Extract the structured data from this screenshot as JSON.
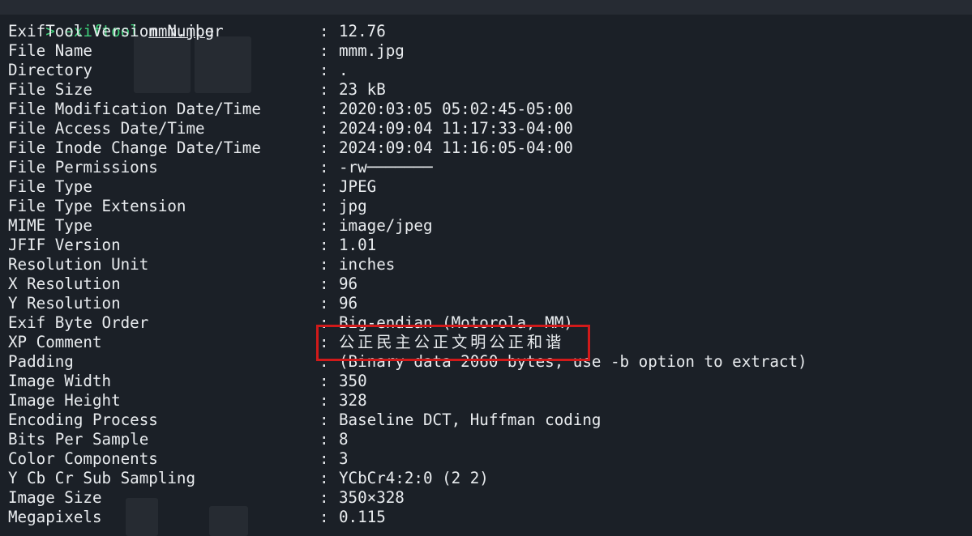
{
  "prompt": {
    "arrow": ">",
    "command": "exiftool",
    "argument": "mmm.jpg"
  },
  "rows": [
    {
      "key": "ExifTool Version Number",
      "value": "12.76"
    },
    {
      "key": "File Name",
      "value": "mmm.jpg"
    },
    {
      "key": "Directory",
      "value": "."
    },
    {
      "key": "File Size",
      "value": "23 kB"
    },
    {
      "key": "File Modification Date/Time",
      "value": "2020:03:05 05:02:45-05:00"
    },
    {
      "key": "File Access Date/Time",
      "value": "2024:09:04 11:17:33-04:00"
    },
    {
      "key": "File Inode Change Date/Time",
      "value": "2024:09:04 11:16:05-04:00"
    },
    {
      "key": "File Permissions",
      "value": "-rw───────"
    },
    {
      "key": "File Type",
      "value": "JPEG"
    },
    {
      "key": "File Type Extension",
      "value": "jpg"
    },
    {
      "key": "MIME Type",
      "value": "image/jpeg"
    },
    {
      "key": "JFIF Version",
      "value": "1.01"
    },
    {
      "key": "Resolution Unit",
      "value": "inches"
    },
    {
      "key": "X Resolution",
      "value": "96"
    },
    {
      "key": "Y Resolution",
      "value": "96"
    },
    {
      "key": "Exif Byte Order",
      "value": "Big-endian (Motorola, MM)"
    },
    {
      "key": "XP Comment",
      "value": "公正民主公正文明公正和谐"
    },
    {
      "key": "Padding",
      "value": "(Binary data 2060 bytes, use -b option to extract)"
    },
    {
      "key": "Image Width",
      "value": "350"
    },
    {
      "key": "Image Height",
      "value": "328"
    },
    {
      "key": "Encoding Process",
      "value": "Baseline DCT, Huffman coding"
    },
    {
      "key": "Bits Per Sample",
      "value": "8"
    },
    {
      "key": "Color Components",
      "value": "3"
    },
    {
      "key": "Y Cb Cr Sub Sampling",
      "value": "YCbCr4:2:0 (2 2)"
    },
    {
      "key": "Image Size",
      "value": "350×328"
    },
    {
      "key": "Megapixels",
      "value": "0.115"
    }
  ],
  "separator": ":",
  "colors": {
    "background": "#1b2027",
    "text": "#e9ecef",
    "prompt": "#3fd07a",
    "highlight": "#d11a1a"
  }
}
